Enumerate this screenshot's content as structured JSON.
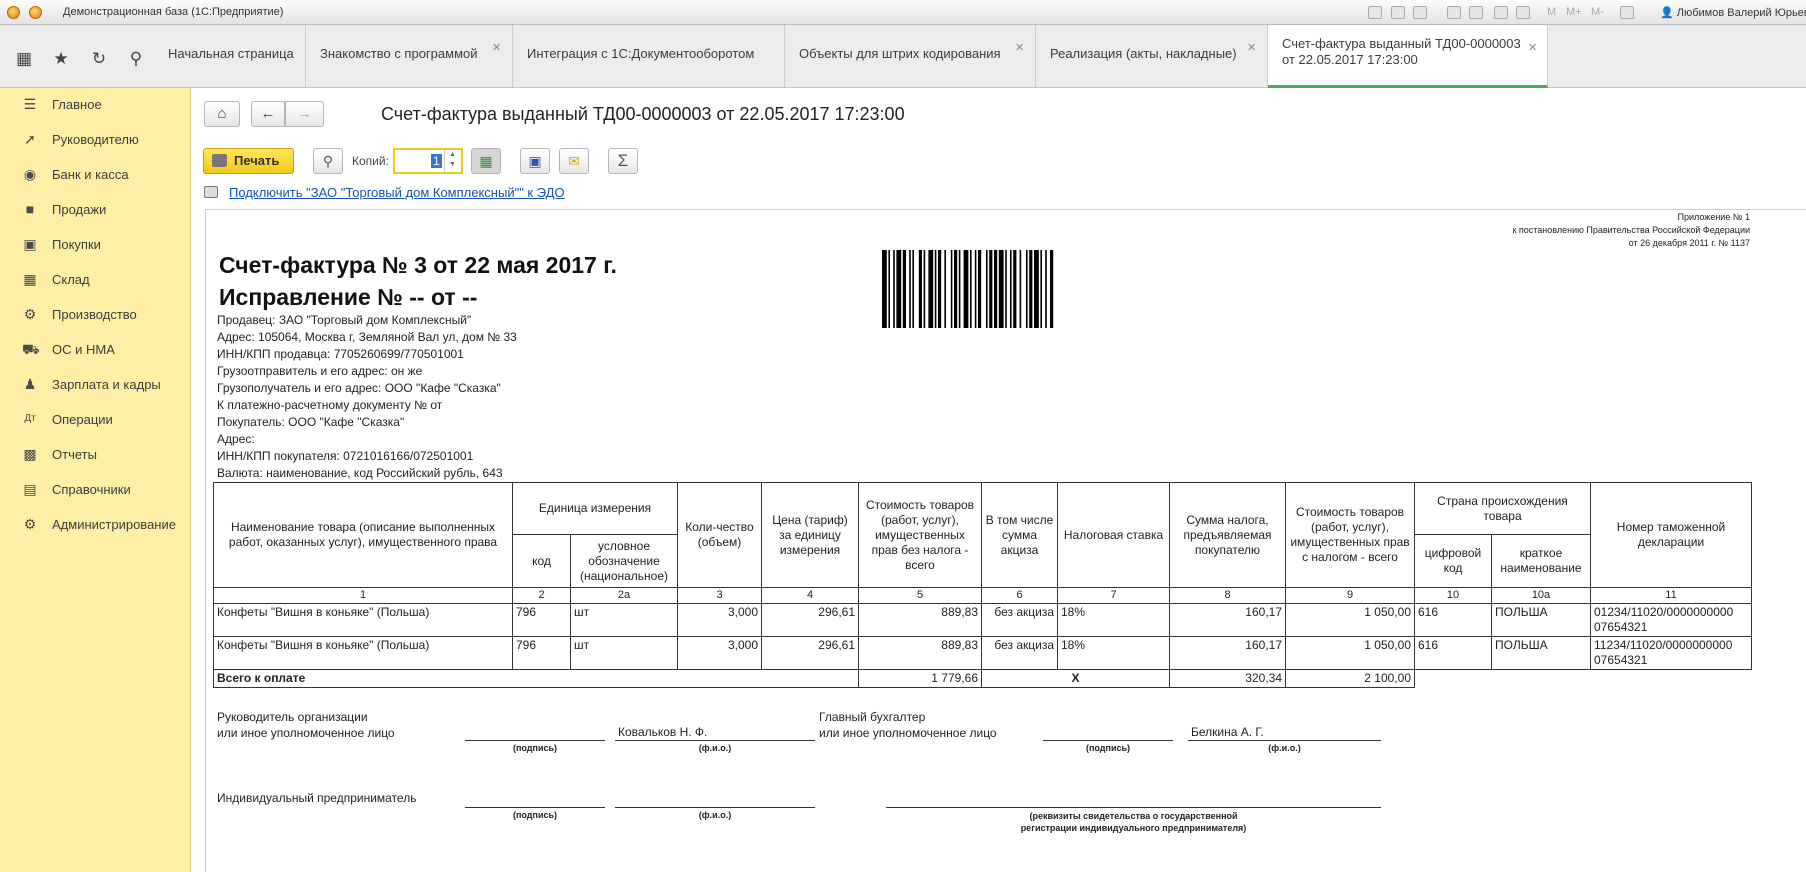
{
  "window": {
    "title": "Демонстрационная база  (1С:Предприятие)",
    "zoom_labels": [
      "M",
      "M+",
      "M-"
    ],
    "user": "Любимов Валерий Юрьевич"
  },
  "tabs": [
    {
      "label": "Начальная страница",
      "closable": false
    },
    {
      "label": "Знакомство с программой",
      "closable": true
    },
    {
      "label": "Интеграция с 1С:Документооборотом",
      "closable": false
    },
    {
      "label": "Объекты для штрих кодирования",
      "closable": true
    },
    {
      "label": "Реализация (акты, накладные)",
      "closable": true
    },
    {
      "label_line1": "Счет-фактура выданный ТД00-0000003",
      "label_line2": "от 22.05.2017 17:23:00",
      "closable": true,
      "active": true
    }
  ],
  "sidebar": {
    "items": [
      {
        "label": "Главное",
        "icon": "menu-lines-icon"
      },
      {
        "label": "Руководителю",
        "icon": "trend-icon"
      },
      {
        "label": "Банк и касса",
        "icon": "ruble-coin-icon"
      },
      {
        "label": "Продажи",
        "icon": "bag-icon"
      },
      {
        "label": "Покупки",
        "icon": "cart-icon"
      },
      {
        "label": "Склад",
        "icon": "warehouse-icon"
      },
      {
        "label": "Производство",
        "icon": "factory-icon"
      },
      {
        "label": "ОС и НМА",
        "icon": "truck-icon"
      },
      {
        "label": "Зарплата и кадры",
        "icon": "person-icon"
      },
      {
        "label": "Операции",
        "icon": "dt-kt-icon"
      },
      {
        "label": "Отчеты",
        "icon": "bar-chart-icon"
      },
      {
        "label": "Справочники",
        "icon": "books-icon"
      },
      {
        "label": "Администрирование",
        "icon": "gear-icon"
      }
    ]
  },
  "header": {
    "doc_title": "Счет-фактура выданный ТД00-0000003 от 22.05.2017 17:23:00"
  },
  "toolbar": {
    "print_label": "Печать",
    "copies_label": "Копий:",
    "copies_value": "1",
    "sum_symbol": "Σ"
  },
  "edo_link": "Подключить \"ЗАО \"Торговый дом Комплексный\"\" к ЭДО",
  "document": {
    "appendix": [
      "Приложение № 1",
      "к постановлению Правительства Российской Федерации",
      "от 26 декабря 2011 г. № 1137"
    ],
    "title": "Счет-фактура № 3 от 22 мая 2017 г.",
    "correction": "Исправление № -- от --",
    "info": [
      "Продавец: ЗАО \"Торговый дом Комплексный\"",
      "Адрес: 105064, Москва г, Земляной Вал ул, дом № 33",
      "ИНН/КПП продавца: 7705260699/770501001",
      "Грузоотправитель и его адрес: он же",
      "Грузополучатель и его адрес: ООО \"Кафе \"Сказка\"",
      "К платежно-расчетному документу №     от",
      "Покупатель: ООО \"Кафе \"Сказка\"",
      "Адрес:",
      "ИНН/КПП покупателя: 0721016166/072501001",
      "Валюта: наименование, код Российский рубль, 643"
    ],
    "table": {
      "h_name": "Наименование товара (описание выполненных работ, оказанных услуг), имущественного права",
      "h_unit": "Единица измерения",
      "h_unit_code": "код",
      "h_unit_sym": "условное обозначение (национальное)",
      "h_qty": "Коли-чество (объем)",
      "h_price": "Цена (тариф) за единицу измерения",
      "h_cost_no_tax": "Стоимость товаров (работ, услуг), имущественных прав без налога - всего",
      "h_excise": "В том числе сумма акциза",
      "h_rate": "Налоговая ставка",
      "h_tax": "Сумма налога, предъявляемая покупателю",
      "h_cost_tax": "Стоимость товаров (работ, услуг), имущественных прав с налогом - всего",
      "h_country": "Страна происхождения товара",
      "h_country_code": "цифровой код",
      "h_country_name": "краткое наименование",
      "h_customs": "Номер таможенной декларации",
      "col_numbers": [
        "1",
        "2",
        "2а",
        "3",
        "4",
        "5",
        "6",
        "7",
        "8",
        "9",
        "10",
        "10а",
        "11"
      ],
      "rows": [
        {
          "name": "Конфеты \"Вишня в коньяке\"  (Польша)",
          "code": "796",
          "unit": "шт",
          "qty": "3,000",
          "price": "296,61",
          "cost": "889,83",
          "excise": "без акциза",
          "rate": "18%",
          "tax": "160,17",
          "total": "1 050,00",
          "country_code": "616",
          "country": "ПОЛЬША",
          "customs": "01234/11020/0000000000 07654321"
        },
        {
          "name": "Конфеты \"Вишня в коньяке\"  (Польша)",
          "code": "796",
          "unit": "шт",
          "qty": "3,000",
          "price": "296,61",
          "cost": "889,83",
          "excise": "без акциза",
          "rate": "18%",
          "tax": "160,17",
          "total": "1 050,00",
          "country_code": "616",
          "country": "ПОЛЬША",
          "customs": "11234/11020/0000000000 07654321"
        }
      ],
      "total_label": "Всего к оплате",
      "total_cost": "1 779,66",
      "total_excise": "X",
      "total_tax": "320,34",
      "total_sum": "2 100,00"
    },
    "signatures": {
      "head_label_1": "Руководитель организации",
      "head_label_2": "или иное уполномоченное лицо",
      "head_name": "Ковальков  Н. Ф.",
      "chief_label_1": "Главный бухгалтер",
      "chief_label_2": "или иное уполномоченное лицо",
      "chief_name": "Белкина А. Г.",
      "caption_sign": "(подпись)",
      "caption_fio": "(ф.и.о.)",
      "ip_label": "Индивидуальный предприниматель",
      "ip_caption_1": "(реквизиты свидетельства о государственной",
      "ip_caption_2": "регистрации индивидуального предпринимателя)"
    }
  },
  "colors": {
    "sidebar_bg": "#fdf0a6",
    "print_button": "#f5d02a",
    "active_tab_underline": "#4aa86a",
    "link": "#1552b3"
  }
}
